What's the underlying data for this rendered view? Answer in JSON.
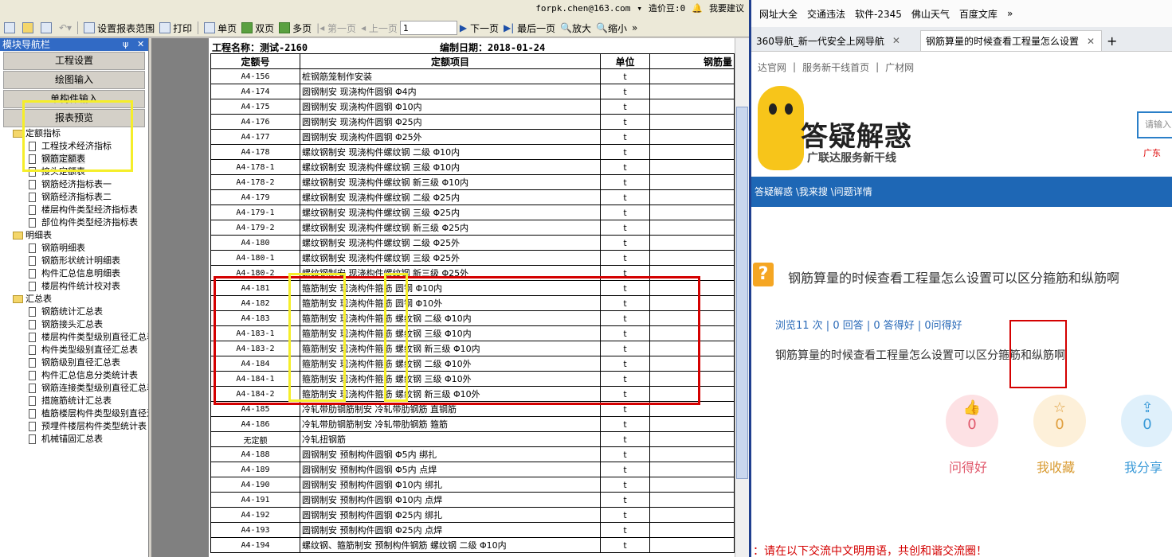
{
  "toolbar": {
    "set_range": "设置报表范围",
    "print": "打印",
    "single_page": "单页",
    "double_page": "双页",
    "multi_page": "多页",
    "first_page": "第一页",
    "prev_page": "上一页",
    "page_number": "1",
    "next_page": "下一页",
    "last_page": "最后一页",
    "zoom_in": "放大",
    "zoom_out": "缩小"
  },
  "account": {
    "email": "forpk.chen@163.com",
    "beans": "造价豆:0",
    "feedback": "我要建议"
  },
  "nav": {
    "title": "模块导航栏",
    "tabs": [
      "工程设置",
      "绘图输入",
      "单构件输入",
      "报表预览"
    ],
    "tree": [
      {
        "type": "folder",
        "label": "定额指标"
      },
      {
        "type": "leaf",
        "label": "工程技术经济指标"
      },
      {
        "type": "leaf",
        "label": "钢筋定额表",
        "selected": true
      },
      {
        "type": "leaf",
        "label": "接头定额表"
      },
      {
        "type": "leaf",
        "label": "钢筋经济指标表一"
      },
      {
        "type": "leaf",
        "label": "钢筋经济指标表二"
      },
      {
        "type": "leaf",
        "label": "楼层构件类型经济指标表"
      },
      {
        "type": "leaf",
        "label": "部位构件类型经济指标表"
      },
      {
        "type": "folder",
        "label": "明细表"
      },
      {
        "type": "leaf",
        "label": "钢筋明细表"
      },
      {
        "type": "leaf",
        "label": "钢筋形状统计明细表"
      },
      {
        "type": "leaf",
        "label": "构件汇总信息明细表"
      },
      {
        "type": "leaf",
        "label": "楼层构件统计校对表"
      },
      {
        "type": "folder",
        "label": "汇总表"
      },
      {
        "type": "leaf",
        "label": "钢筋统计汇总表"
      },
      {
        "type": "leaf",
        "label": "钢筋接头汇总表"
      },
      {
        "type": "leaf",
        "label": "楼层构件类型级别直径汇总表"
      },
      {
        "type": "leaf",
        "label": "构件类型级别直径汇总表"
      },
      {
        "type": "leaf",
        "label": "钢筋级别直径汇总表"
      },
      {
        "type": "leaf",
        "label": "构件汇总信息分类统计表"
      },
      {
        "type": "leaf",
        "label": "钢筋连接类型级别直径汇总表"
      },
      {
        "type": "leaf",
        "label": "措施筋统计汇总表"
      },
      {
        "type": "leaf",
        "label": "植筋楼层构件类型级别直径汇总表"
      },
      {
        "type": "leaf",
        "label": "预埋件楼层构件类型统计表"
      },
      {
        "type": "leaf",
        "label": "机械锚固汇总表"
      }
    ]
  },
  "report": {
    "project_label": "工程名称：测试-2160",
    "date_label": "编制日期：2018-01-24",
    "headers": [
      "定额号",
      "定额项目",
      "单位",
      "钢筋量"
    ],
    "rows": [
      [
        "A4-156",
        "桩钢筋笼制作安装",
        "t",
        ""
      ],
      [
        "A4-174",
        "圆钢制安 现浇构件圆钢 Φ4内",
        "t",
        ""
      ],
      [
        "A4-175",
        "圆钢制安 现浇构件圆钢 Φ10内",
        "t",
        ""
      ],
      [
        "A4-176",
        "圆钢制安 现浇构件圆钢 Φ25内",
        "t",
        ""
      ],
      [
        "A4-177",
        "圆钢制安 现浇构件圆钢 Φ25外",
        "t",
        ""
      ],
      [
        "A4-178",
        "螺纹钢制安 现浇构件螺纹钢 二级 Φ10内",
        "t",
        ""
      ],
      [
        "A4-178-1",
        "螺纹钢制安 现浇构件螺纹钢 三级 Φ10内",
        "t",
        ""
      ],
      [
        "A4-178-2",
        "螺纹钢制安 现浇构件螺纹钢 新三级 Φ10内",
        "t",
        ""
      ],
      [
        "A4-179",
        "螺纹钢制安 现浇构件螺纹钢 二级 Φ25内",
        "t",
        ""
      ],
      [
        "A4-179-1",
        "螺纹钢制安 现浇构件螺纹钢 三级 Φ25内",
        "t",
        ""
      ],
      [
        "A4-179-2",
        "螺纹钢制安 现浇构件螺纹钢 新三级 Φ25内",
        "t",
        ""
      ],
      [
        "A4-180",
        "螺纹钢制安 现浇构件螺纹钢 二级 Φ25外",
        "t",
        ""
      ],
      [
        "A4-180-1",
        "螺纹钢制安 现浇构件螺纹钢 三级 Φ25外",
        "t",
        ""
      ],
      [
        "A4-180-2",
        "螺纹钢制安 现浇构件螺纹钢 新三级 Φ25外",
        "t",
        ""
      ],
      [
        "A4-181",
        "箍筋制安 现浇构件箍筋 圆钢 Φ10内",
        "t",
        ""
      ],
      [
        "A4-182",
        "箍筋制安 现浇构件箍筋 圆钢 Φ10外",
        "t",
        ""
      ],
      [
        "A4-183",
        "箍筋制安 现浇构件箍筋 螺纹钢 二级 Φ10内",
        "t",
        ""
      ],
      [
        "A4-183-1",
        "箍筋制安 现浇构件箍筋 螺纹钢 三级 Φ10内",
        "t",
        ""
      ],
      [
        "A4-183-2",
        "箍筋制安 现浇构件箍筋 螺纹钢 新三级 Φ10内",
        "t",
        ""
      ],
      [
        "A4-184",
        "箍筋制安 现浇构件箍筋 螺纹钢 二级 Φ10外",
        "t",
        ""
      ],
      [
        "A4-184-1",
        "箍筋制安 现浇构件箍筋 螺纹钢 三级 Φ10外",
        "t",
        ""
      ],
      [
        "A4-184-2",
        "箍筋制安 现浇构件箍筋 螺纹钢 新三级 Φ10外",
        "t",
        ""
      ],
      [
        "A4-185",
        "冷轧带肋钢筋制安 冷轧带肋钢筋 直钢筋",
        "t",
        ""
      ],
      [
        "A4-186",
        "冷轧带肋钢筋制安 冷轧带肋钢筋 箍筋",
        "t",
        ""
      ],
      [
        "无定额",
        "冷轧扭钢筋",
        "t",
        ""
      ],
      [
        "A4-188",
        "圆钢制安 预制构件圆钢 Φ5内 绑扎",
        "t",
        ""
      ],
      [
        "A4-189",
        "圆钢制安 预制构件圆钢 Φ5内 点焊",
        "t",
        ""
      ],
      [
        "A4-190",
        "圆钢制安 预制构件圆钢 Φ10内 绑扎",
        "t",
        ""
      ],
      [
        "A4-191",
        "圆钢制安 预制构件圆钢 Φ10内 点焊",
        "t",
        ""
      ],
      [
        "A4-192",
        "圆钢制安 预制构件圆钢 Φ25内 绑扎",
        "t",
        ""
      ],
      [
        "A4-193",
        "圆钢制安 预制构件圆钢 Φ25内 点焊",
        "t",
        ""
      ],
      [
        "A4-194",
        "螺纹钢、箍筋制安 预制构件钢筋 螺纹钢 二级 Φ10内",
        "t",
        ""
      ]
    ]
  },
  "browser": {
    "bookmarks": [
      "网址大全",
      "交通违法",
      "软件-2345",
      "佛山天气",
      "百度文库"
    ],
    "tabs": [
      {
        "label": "360导航_新一代安全上网导航",
        "active": false
      },
      {
        "label": "钢筋算量的时候查看工程量怎么设置",
        "active": true
      }
    ],
    "site_links": [
      "达官网",
      "服务新干线首页",
      "广材网"
    ],
    "logo_title": "答疑解惑",
    "logo_sub": "广联达服务新干线",
    "search_placeholder": "请输入",
    "region_text": "广东",
    "breadcrumb": "答疑解惑 \\我来搜 \\问题详情",
    "question_title": "钢筋算量的时候查看工程量怎么设置可以区分箍筋和纵筋啊",
    "stats": "浏览11 次 | 0 回答 | 0 答得好 | 0问得好",
    "question_body": "钢筋算量的时候查看工程量怎么设置可以区分箍筋和纵筋啊",
    "actions": [
      {
        "label": "问得好",
        "count": "0",
        "icon": "thumbs-up-icon"
      },
      {
        "label": "我收藏",
        "count": "0",
        "icon": "star-icon"
      },
      {
        "label": "我分享",
        "count": "0",
        "icon": "share-icon"
      }
    ],
    "footnote": "：请在以下交流中文明用语，共创和谐交流圈！"
  },
  "colors": {
    "highlight_yellow": "#f5ee2a",
    "highlight_red": "#d40000",
    "brand_blue": "#1e67b5",
    "nav_title_blue": "#316ac5"
  }
}
